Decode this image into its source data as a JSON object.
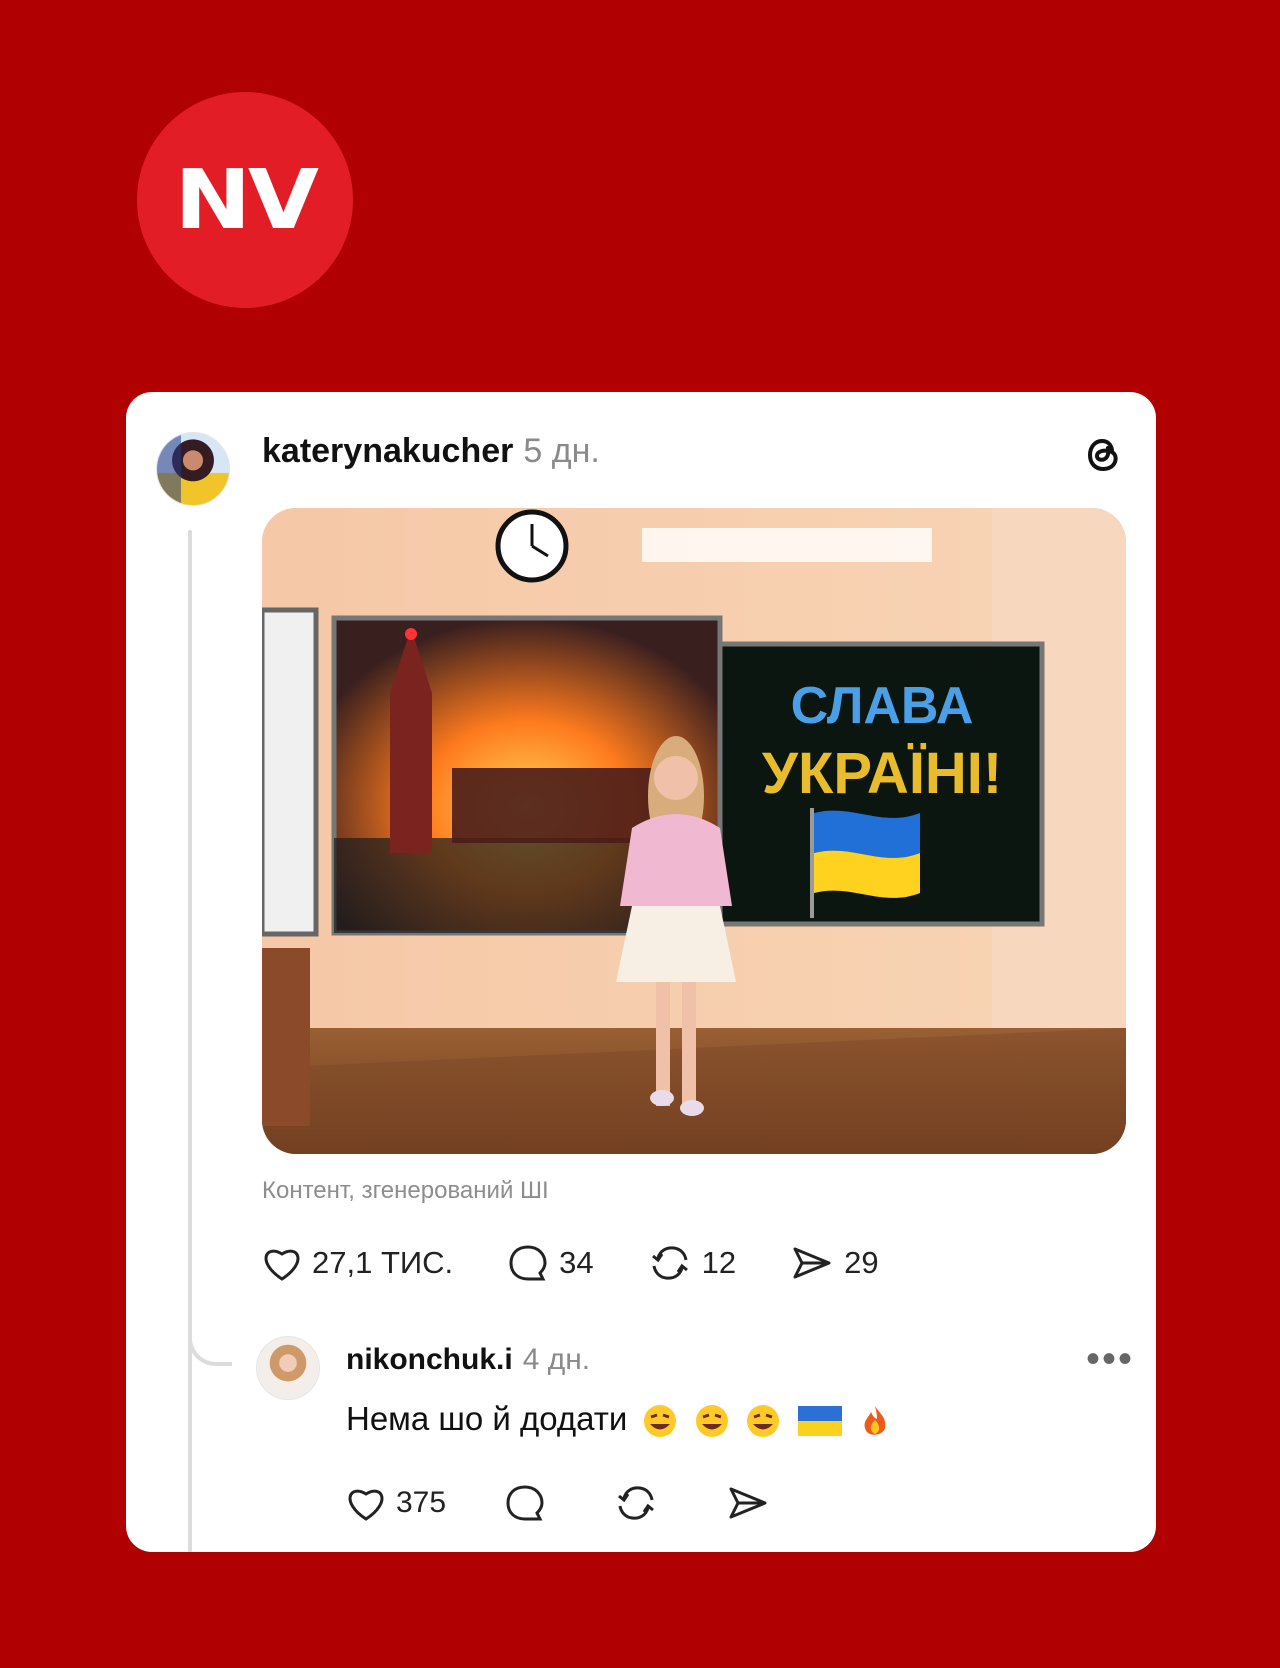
{
  "brand": {
    "logo_text": "NV"
  },
  "post": {
    "username": "katerynakucher",
    "time": "5 дн.",
    "ai_label": "Контент, згенерований ШІ",
    "likes": "27,1 ТИС.",
    "comments": "34",
    "reposts": "12",
    "shares": "29",
    "blackboard_line1": "СЛАВА",
    "blackboard_line2": "УКРАЇНІ!"
  },
  "reply": {
    "username": "nikonchuk.i",
    "time": "4 дн.",
    "text": "Нема шо й додати",
    "likes": "375",
    "more_label": "•••"
  },
  "icons": {
    "threads": "threads-logo-icon",
    "like": "heart-icon",
    "comment": "speech-bubble-icon",
    "repost": "repost-icon",
    "share": "send-icon"
  },
  "colors": {
    "background": "#b00002",
    "logo": "#e21d26",
    "card": "#ffffff"
  }
}
